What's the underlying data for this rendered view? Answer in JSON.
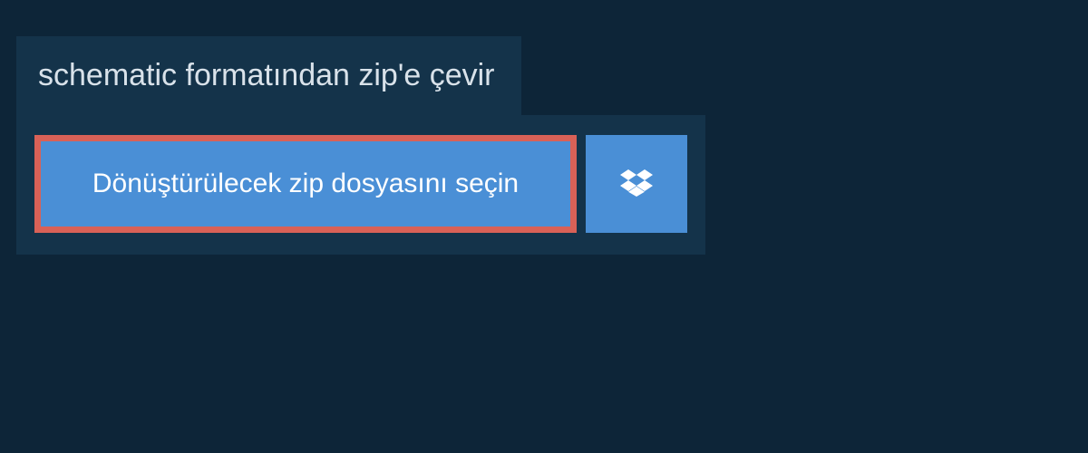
{
  "tab": {
    "label": "schematic formatından zip'e çevir"
  },
  "buttons": {
    "select_file": "Dönüştürülecek zip dosyasını seçin"
  }
}
